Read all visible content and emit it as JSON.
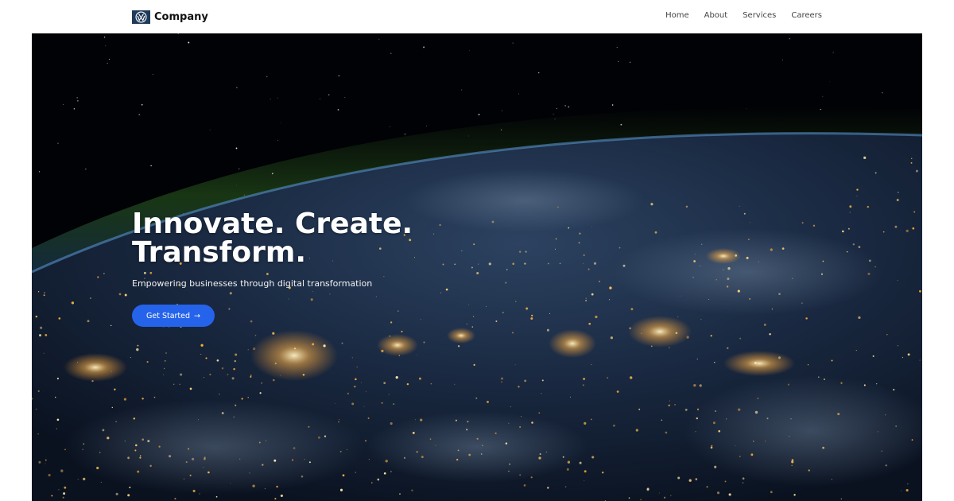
{
  "header": {
    "brand_name": "Company",
    "logo_icon": "vw-logo-icon",
    "nav": [
      {
        "label": "Home"
      },
      {
        "label": "About"
      },
      {
        "label": "Services"
      },
      {
        "label": "Careers"
      }
    ]
  },
  "hero": {
    "title_line1": "Innovate. Create.",
    "title_line2": "Transform.",
    "subtitle": "Empowering businesses through digital transformation",
    "cta_label": "Get Started",
    "cta_arrow": "→",
    "background": "earth-at-night-from-space"
  },
  "colors": {
    "accent": "#2563eb",
    "logo_bg": "#1f3a5a",
    "nav_text": "#444444"
  }
}
